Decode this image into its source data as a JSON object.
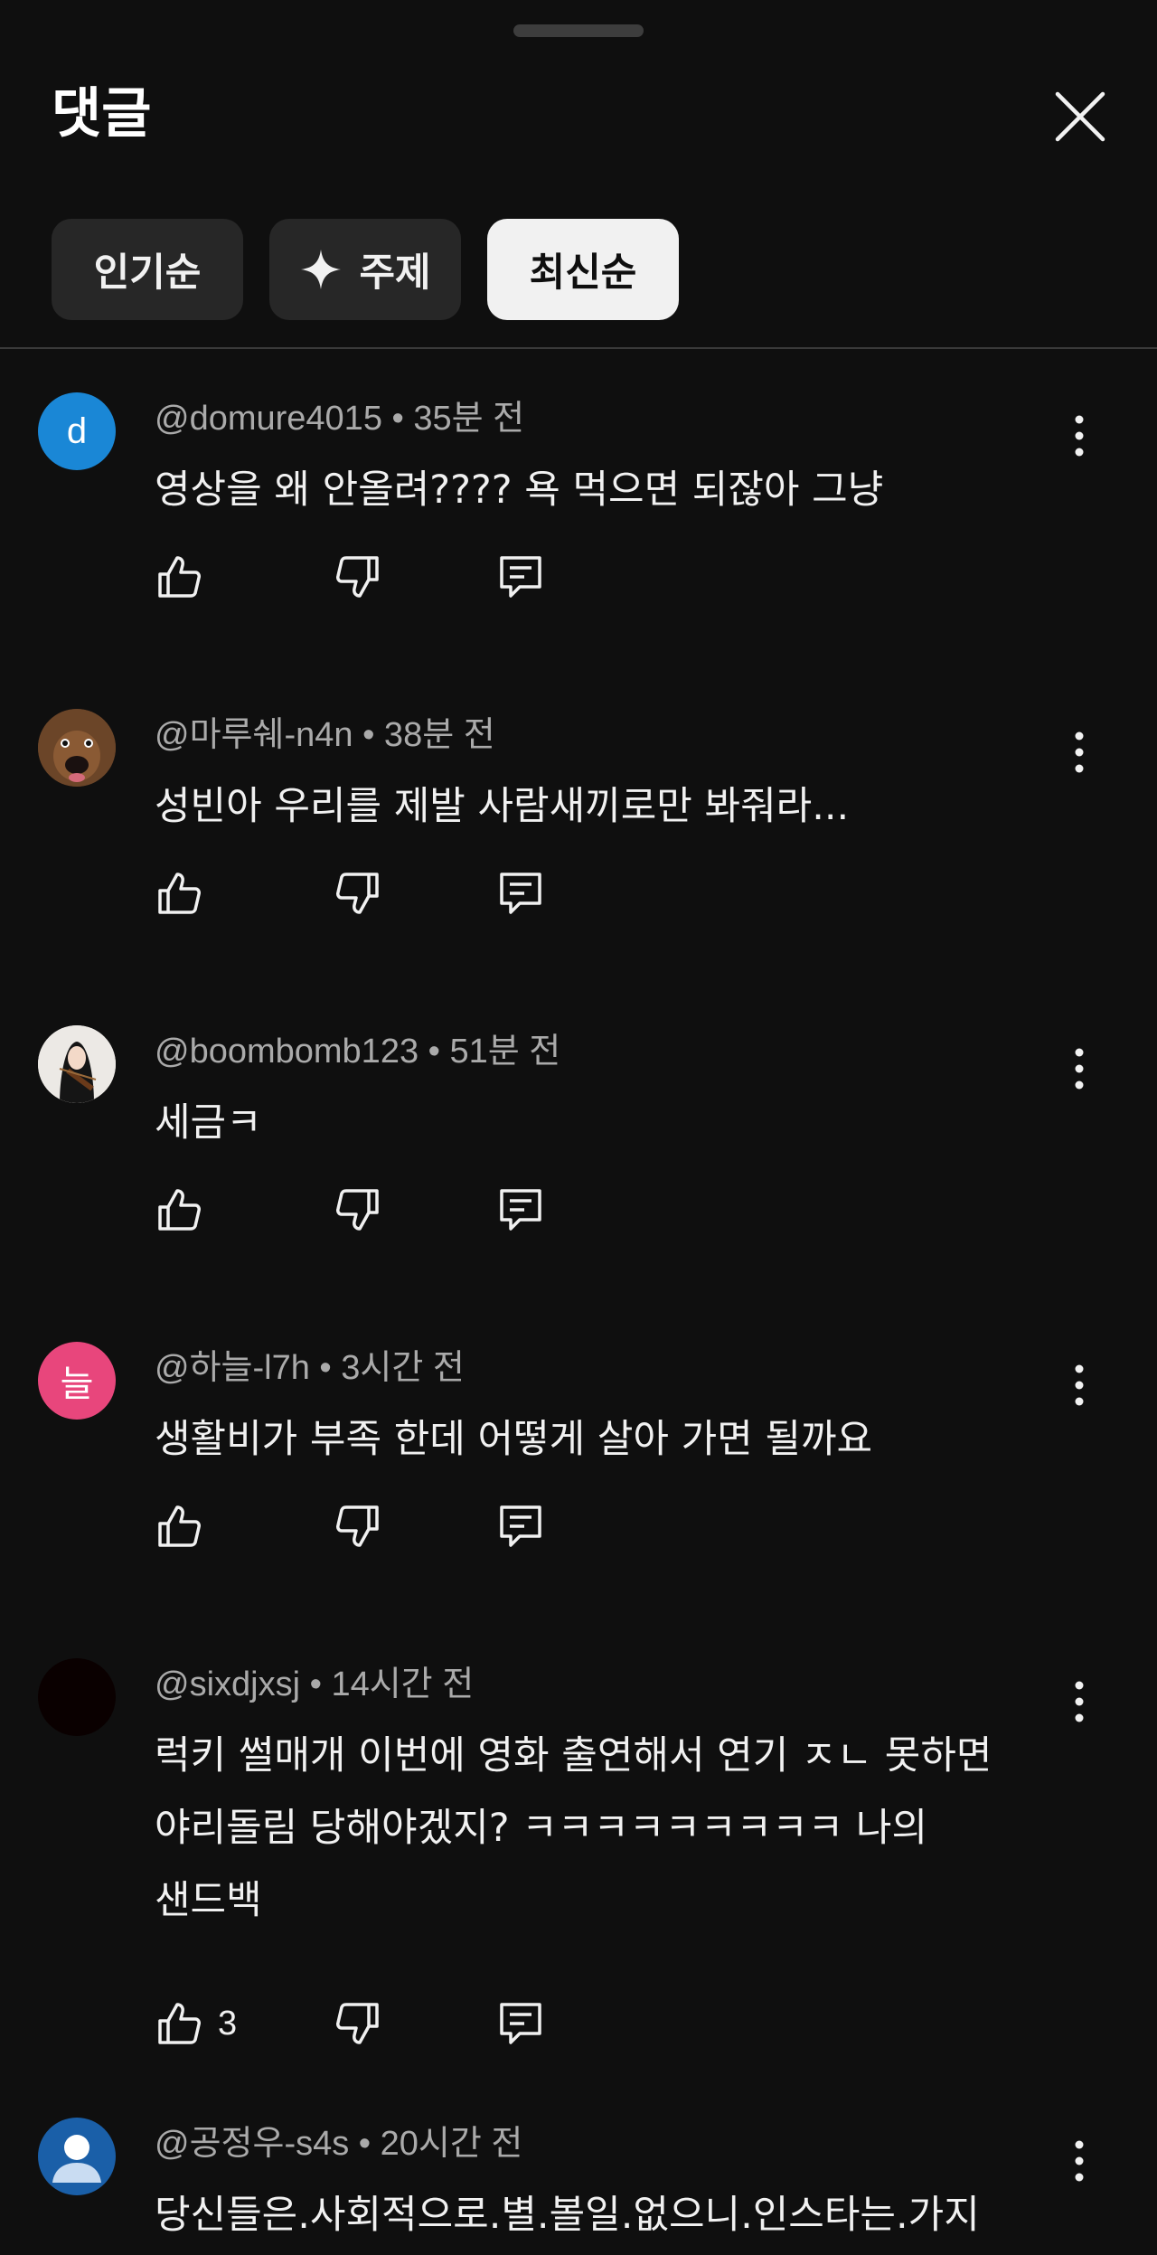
{
  "header": {
    "title": "댓글",
    "close_icon": "close-icon"
  },
  "chips": [
    {
      "label": "인기순",
      "selected": false
    },
    {
      "label": "주제",
      "icon": "sparkle-icon",
      "selected": false
    },
    {
      "label": "최신순",
      "selected": true
    }
  ],
  "comments": [
    {
      "author": "@domure4015",
      "time": "35분 전",
      "meta": "@domure4015 • 35분 전",
      "text": "영상을 왜 안올려???? 욕 먹으면 되잖아 그냥",
      "avatar": {
        "type": "letter",
        "letter": "d",
        "color": "#1a87d6"
      },
      "likes": ""
    },
    {
      "author": "@마루쉐-n4n",
      "time": "38분 전",
      "meta": "@마루쉐-n4n • 38분 전",
      "text": "성빈아 우리를 제발 사람새끼로만 봐줘라...",
      "avatar": {
        "type": "photo",
        "description_icon": "dog-avatar"
      },
      "likes": ""
    },
    {
      "author": "@boombomb123",
      "time": "51분 전",
      "meta": "@boombomb123 • 51분 전",
      "text": "세금ㅋ",
      "avatar": {
        "type": "photo",
        "description_icon": "person-violin-avatar"
      },
      "likes": ""
    },
    {
      "author": "@하늘-l7h",
      "time": "3시간 전",
      "meta": "@하늘-l7h • 3시간 전",
      "text": "생활비가 부족 한데 어떻게 살아 가면 될까요",
      "avatar": {
        "type": "letter",
        "letter": "늘",
        "color": "#e8467c"
      },
      "likes": ""
    },
    {
      "author": "@sixdjxsj",
      "time": "14시간 전",
      "meta": "@sixdjxsj • 14시간 전",
      "text": "럭키 썰매개 이번에 영화 출연해서 연기 ㅈㄴ 못하면\n야리돌림 당해야겠지? ㅋㅋㅋㅋㅋㅋㅋㅋㅋ 나의\n샌드백",
      "avatar": {
        "type": "dark",
        "color": "#0a0000"
      },
      "likes": "3"
    },
    {
      "author": "@공정우-s4s",
      "time": "20시간 전",
      "meta": "@공정우-s4s • 20시간 전",
      "text": "당신들은.사회적으로.별.볼일.없으니.인스타는.가지",
      "avatar": {
        "type": "default-user",
        "color": "#1a5fa8"
      },
      "likes": ""
    }
  ],
  "icons": {
    "like": "thumbs-up-icon",
    "dislike": "thumbs-down-icon",
    "reply": "reply-icon",
    "more": "more-vert-icon"
  },
  "colors": {
    "background": "#0f0f0f",
    "chip_bg": "#272727",
    "chip_selected_bg": "#f1f1f1",
    "meta_text": "#aaaaaa",
    "primary_text": "#f1f1f1"
  }
}
